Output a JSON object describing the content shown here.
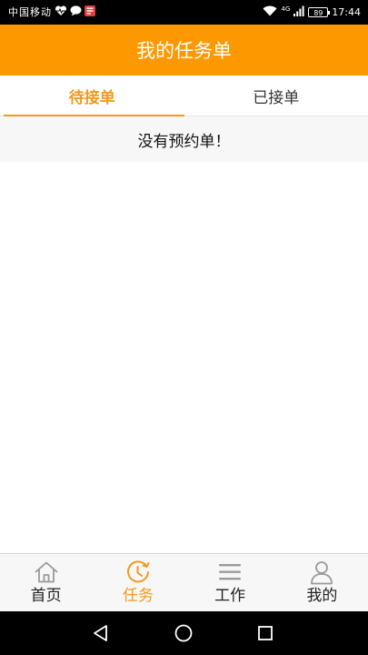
{
  "status_bar": {
    "carrier": "中国移动",
    "network_type": "4G",
    "battery": "89",
    "time": "17:44",
    "icons": [
      "heart-pulse-icon",
      "chat-bubble-icon",
      "news-app-icon",
      "wifi-icon",
      "signal-icon",
      "battery-icon"
    ]
  },
  "header": {
    "title": "我的任务单"
  },
  "tabs": [
    {
      "label": "待接单",
      "active": true
    },
    {
      "label": "已接单",
      "active": false
    }
  ],
  "main": {
    "empty_message": "没有预约单！"
  },
  "bottom_nav": [
    {
      "label": "首页",
      "icon": "home-icon",
      "active": false
    },
    {
      "label": "任务",
      "icon": "task-clock-icon",
      "active": true
    },
    {
      "label": "工作",
      "icon": "menu-lines-icon",
      "active": false
    },
    {
      "label": "我的",
      "icon": "user-icon",
      "active": false
    }
  ],
  "system_nav": {
    "icons": [
      "back-icon",
      "home-circle-icon",
      "recent-apps-icon"
    ]
  },
  "colors": {
    "accent": "#fe9800",
    "active_text": "#f39a1e",
    "status_bar": "#000000",
    "nav_background": "#f7f7f7"
  }
}
